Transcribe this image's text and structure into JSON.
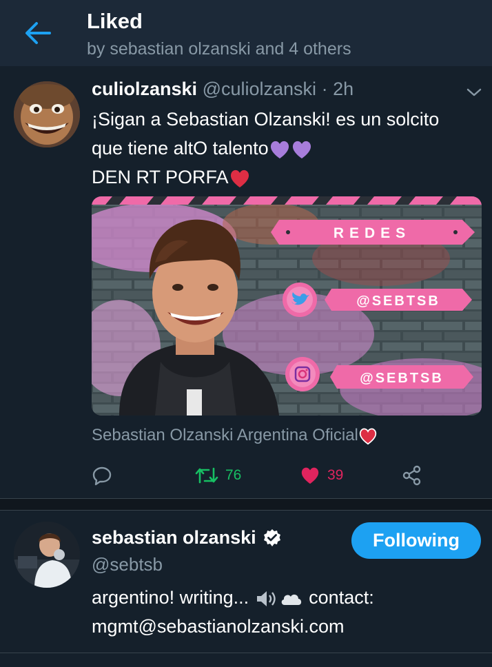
{
  "header": {
    "title": "Liked",
    "subtitle": "by sebastian olzanski and 4 others"
  },
  "tweet": {
    "author_name": "culiolzanski",
    "author_handle": "@culiolzanski",
    "separator": "·",
    "time": "2h",
    "text_line1": "¡Sigan a Sebastian Olzanski! es un solcito",
    "text_line2": "que tiene altO talento",
    "text_line3": "DEN RT PORFA",
    "media": {
      "banner_label": "REDES",
      "twitter_label": "@SEBTSB",
      "instagram_label": "@SEBTSB"
    },
    "media_caption": "Sebastian Olzanski Argentina Oficial",
    "retweet_count": "76",
    "like_count": "39",
    "colors": {
      "retweet": "#17bf63",
      "like": "#e0245e",
      "accent": "#1da1f2"
    }
  },
  "user_card": {
    "name": "sebastian olzanski",
    "handle": "@sebtsb",
    "follow_label": "Following",
    "bio_line1_a": "argentino! writing...",
    "bio_line1_b": "contact:",
    "bio_line2": "mgmt@sebastianolzanski.com"
  },
  "icons": [
    "back-arrow-icon",
    "chevron-down-icon",
    "reply-icon",
    "retweet-icon",
    "heart-icon",
    "share-icon",
    "verified-badge-icon",
    "purple-heart-icon",
    "red-heart-icon",
    "speaker-icon",
    "cloud-icon"
  ]
}
